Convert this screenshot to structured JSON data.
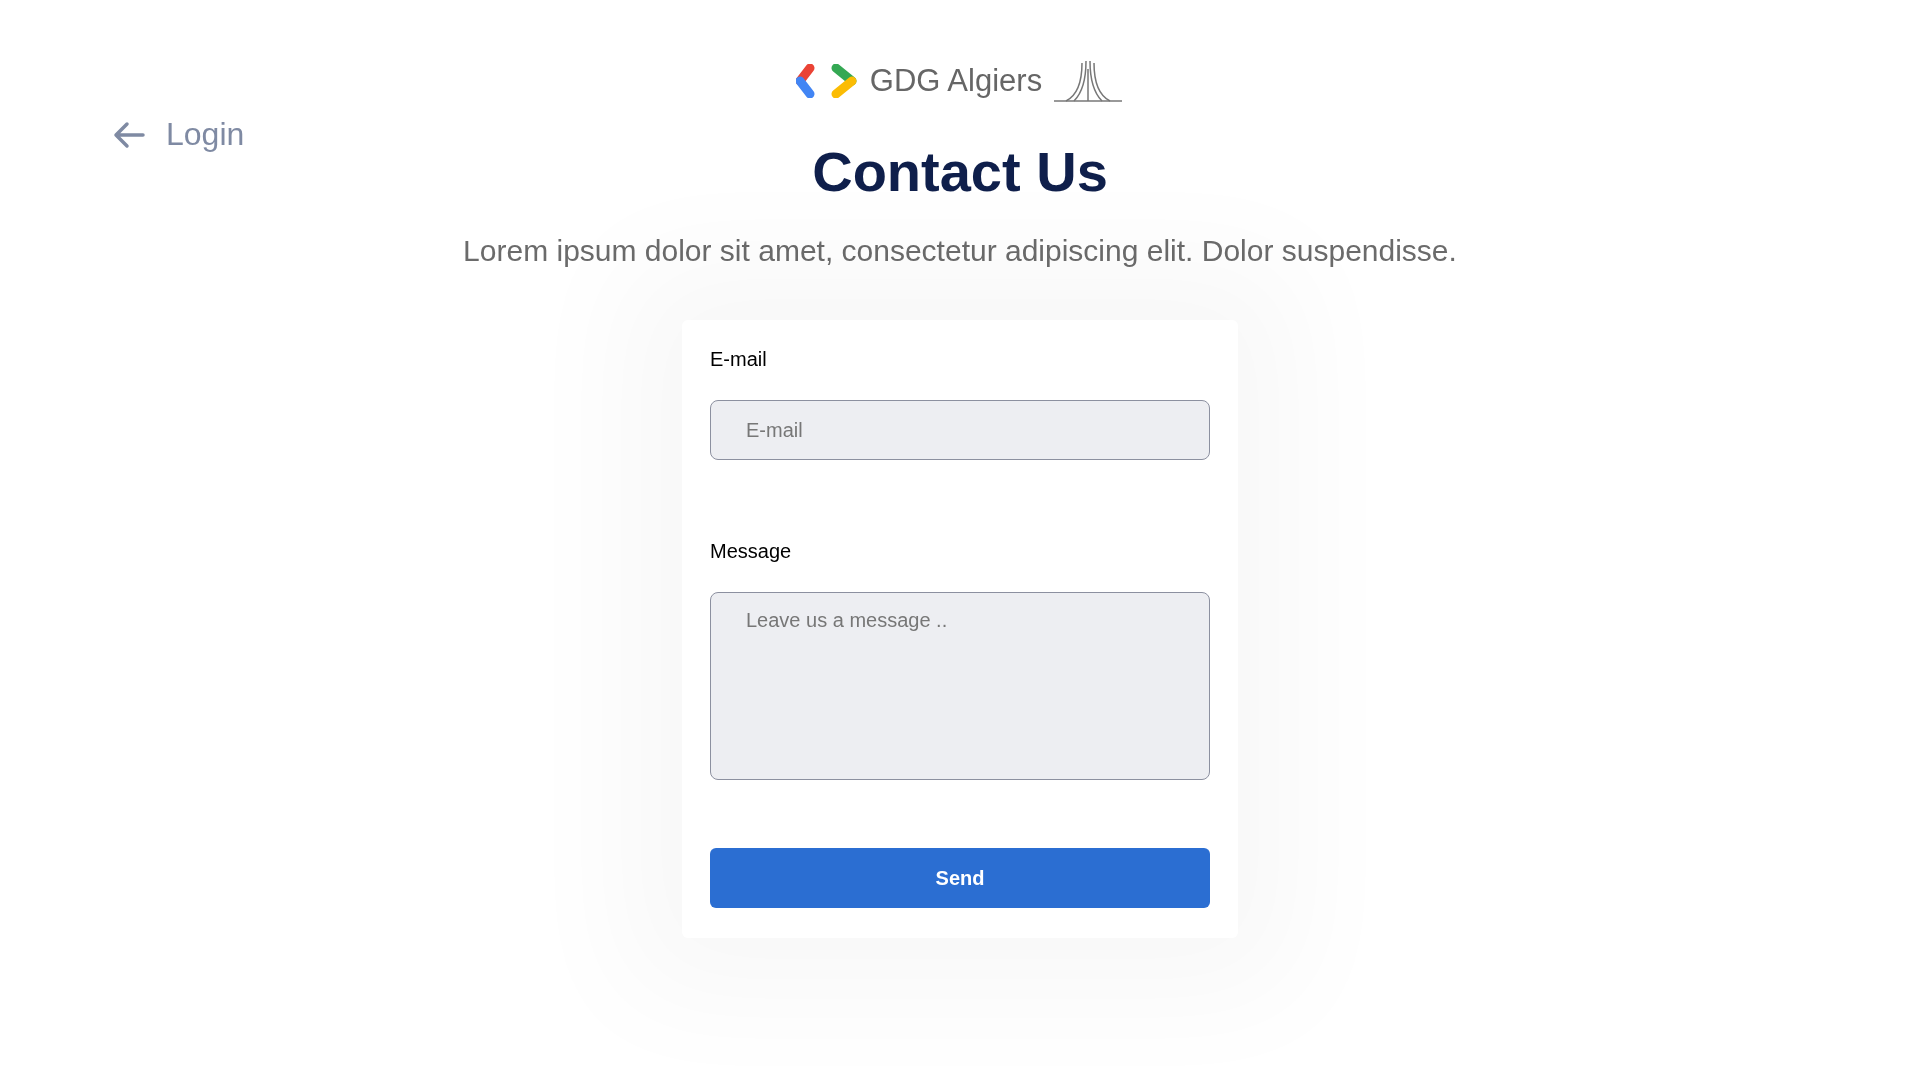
{
  "logo": {
    "text": "GDG Algiers"
  },
  "back_link": {
    "label": "Login"
  },
  "title": "Contact Us",
  "subtitle": "Lorem ipsum dolor sit amet, consectetur adipiscing elit. Dolor suspendisse.",
  "form": {
    "fields": [
      {
        "kind": "input",
        "label": "E-mail",
        "placeholder": "E-mail"
      },
      {
        "kind": "textarea",
        "label": "Message",
        "placeholder": "Leave us a message .."
      }
    ],
    "submit": "Send"
  }
}
